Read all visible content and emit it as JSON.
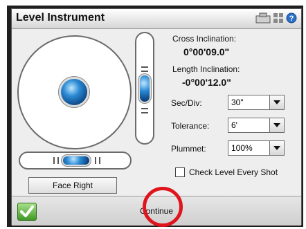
{
  "window": {
    "title": "Level Instrument"
  },
  "readouts": {
    "cross_label": "Cross Inclination:",
    "cross_value": "0°00'09.0\"",
    "length_label": "Length Inclination:",
    "length_value": "-0°00'12.0\""
  },
  "settings": {
    "sec_div": {
      "label": "Sec/Div:",
      "value": "30\""
    },
    "tolerance": {
      "label": "Tolerance:",
      "value": "6'"
    },
    "plummet": {
      "label": "Plummet:",
      "value": "100%"
    }
  },
  "check_level": {
    "label": "Check Level Every Shot",
    "checked": false
  },
  "face_button": {
    "label": "Face Right"
  },
  "footer": {
    "continue_label": "Continue"
  },
  "colors": {
    "bubble": "#2a8ad4",
    "annotation": "#e0141c",
    "ok": "#3f9a25"
  }
}
